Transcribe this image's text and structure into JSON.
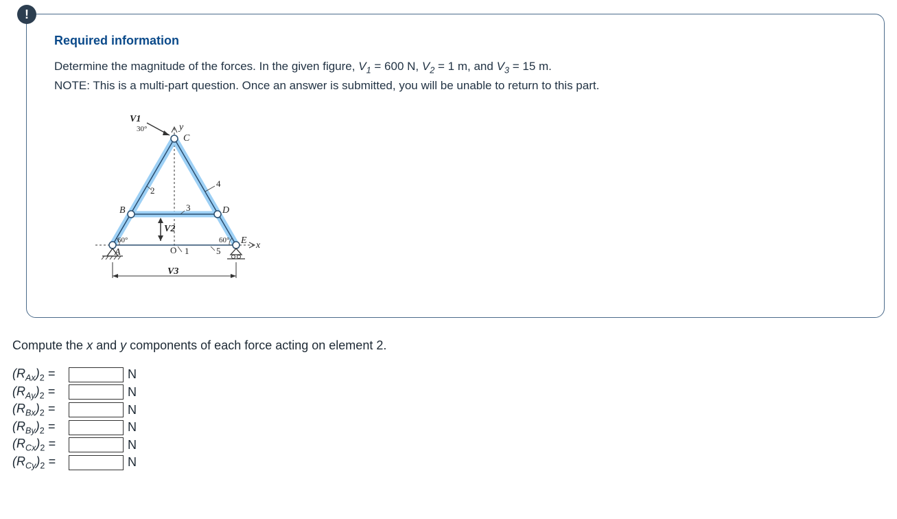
{
  "card": {
    "badge": "!",
    "title": "Required information",
    "prompt_a": "Determine the magnitude of the forces. In the given figure,",
    "v1_sym": "V",
    "v1_sub": "1",
    "v1_eq": " = 600 N,",
    "v2_sym": "V",
    "v2_sub": "2",
    "v2_eq": " = 1 m, and",
    "v3_sym": "V",
    "v3_sub": "3",
    "v3_eq": " = 15 m.",
    "note": "NOTE: This is a multi-part question. Once an answer is submitted, you will be unable to return to this part."
  },
  "diagram": {
    "V1": "V1",
    "V2": "V2",
    "V3": "V3",
    "ang30": "30°",
    "ang60a": "60°",
    "ang60b": "60°",
    "A": "A",
    "B": "B",
    "C": "C",
    "D": "D",
    "E": "E",
    "O": "O",
    "n1": "1",
    "n2": "2",
    "n3": "3",
    "n4": "4",
    "n5": "5",
    "x": "x",
    "y": "y"
  },
  "question": {
    "pre": "Compute the ",
    "x": "x",
    "mid": " and ",
    "y": "y",
    "post": " components of each force acting on element 2."
  },
  "answers": [
    {
      "label_main": "R",
      "label_sub": "Ax",
      "label_suf": "2",
      "unit": "N"
    },
    {
      "label_main": "R",
      "label_sub": "Ay",
      "label_suf": "2",
      "unit": "N"
    },
    {
      "label_main": "R",
      "label_sub": "Bx",
      "label_suf": "2",
      "unit": "N"
    },
    {
      "label_main": "R",
      "label_sub": "By",
      "label_suf": "2",
      "unit": "N"
    },
    {
      "label_main": "R",
      "label_sub": "Cx",
      "label_suf": "2",
      "unit": "N"
    },
    {
      "label_main": "R",
      "label_sub": "Cy",
      "label_suf": "2",
      "unit": "N"
    }
  ]
}
